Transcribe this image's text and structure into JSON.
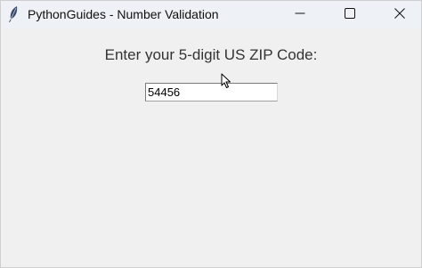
{
  "window": {
    "title": "PythonGuides - Number Validation",
    "controls": {
      "minimize": "minimize-icon",
      "maximize": "maximize-icon",
      "close": "close-icon"
    },
    "app_icon": "feather-icon"
  },
  "form": {
    "prompt": "Enter your 5-digit US ZIP Code:",
    "zip_value": "54456"
  },
  "colors": {
    "titlebar": "#eef1f6",
    "background": "#f0f0f0",
    "input_bg": "#ffffff"
  }
}
